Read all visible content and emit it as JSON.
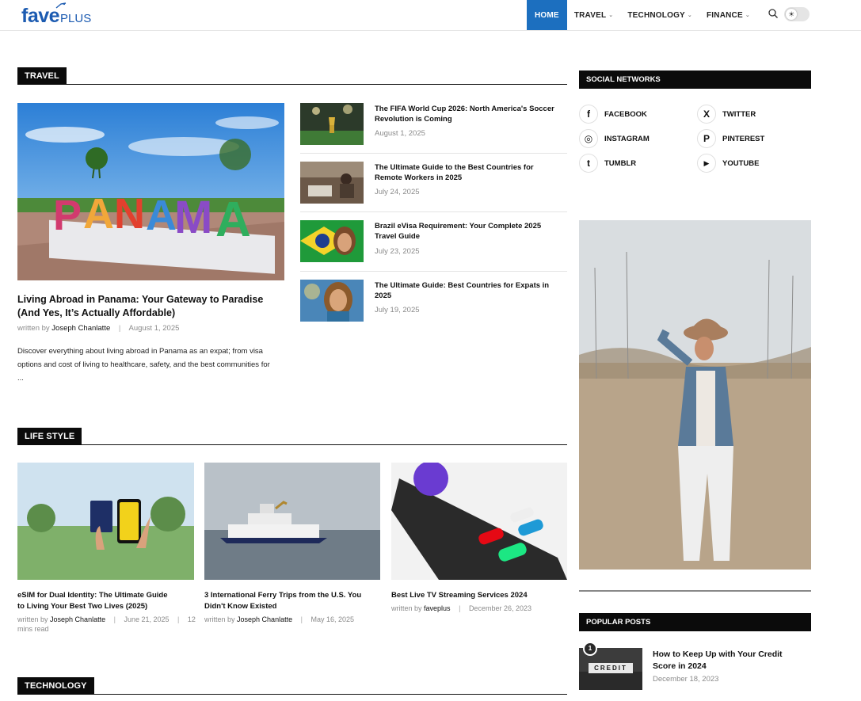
{
  "header": {
    "logo_main": "fave",
    "logo_plus": "PLUS",
    "nav": [
      {
        "label": "HOME",
        "active": true
      },
      {
        "label": "TRAVEL",
        "caret": true
      },
      {
        "label": "TECHNOLOGY",
        "caret": true
      },
      {
        "label": "FINANCE",
        "caret": true
      }
    ],
    "toggle_icon": "sun-icon",
    "accent": "#1c6fbf"
  },
  "travel": {
    "heading": "TRAVEL",
    "featured": {
      "image_icon": "panama-sign-photo",
      "title_line1": "Living Abroad in Panama: Your Gateway to Paradise",
      "title_line2": "(And Yes, It’s Actually Affordable)",
      "written_by": "written by",
      "author": "Joseph Chanlatte",
      "date": "August 1, 2025",
      "excerpt_line1": "Discover everything about living abroad in Panama as an expat; from visa",
      "excerpt_line2": "options and cost of living to healthcare, safety, and the best communities for",
      "excerpt_line3": "..."
    },
    "list": [
      {
        "title_line1": "The FIFA World Cup 2026: North America's Soccer",
        "title_line2": "Revolution is Coming",
        "date": "August 1, 2025"
      },
      {
        "title_line1": "The Ultimate Guide to the Best Countries for",
        "title_line2": "Remote Workers in 2025",
        "date": "July 24, 2025"
      },
      {
        "title_line1": "Brazil eVisa Requirement: Your Complete 2025",
        "title_line2": "Travel Guide",
        "date": "July 23, 2025"
      },
      {
        "title_line1": "The Ultimate Guide: Best Countries for Expats in",
        "title_line2": "2025",
        "date": "July 19, 2025"
      }
    ]
  },
  "lifestyle": {
    "heading": "LIFE STYLE",
    "posts": [
      {
        "title_line1": "eSIM for Dual Identity: The Ultimate Guide",
        "title_line2": "to Living Your Best Two Lives (2025)",
        "written_by": "written by",
        "author": "Joseph Chanlatte",
        "date": "June 21, 2025",
        "extra": "12",
        "extra2": "mins read"
      },
      {
        "title_line1": "3 International Ferry Trips from the U.S. You",
        "title_line2": "Didn't Know Existed",
        "written_by": "written by",
        "author": "Joseph Chanlatte",
        "date": "May 16, 2025"
      },
      {
        "title_line1": "Best Live TV Streaming Services 2024",
        "title_line2": "",
        "written_by": "written by",
        "author": "faveplus",
        "date": "December 26, 2023"
      }
    ]
  },
  "technology": {
    "heading": "TECHNOLOGY"
  },
  "sidebar": {
    "social_heading": "SOCIAL NETWORKS",
    "social": [
      {
        "label": "FACEBOOK",
        "glyph": "f"
      },
      {
        "label": "TWITTER",
        "glyph": "X"
      },
      {
        "label": "INSTAGRAM",
        "glyph": "◎"
      },
      {
        "label": "PINTEREST",
        "glyph": "P"
      },
      {
        "label": "TUMBLR",
        "glyph": "t"
      },
      {
        "label": "YOUTUBE",
        "glyph": "▶"
      }
    ],
    "popular_heading": "POPULAR POSTS",
    "popular": [
      {
        "rank": "1",
        "image_text": "CREDIT",
        "title_line1": "How to Keep Up with Your Credit",
        "title_line2": "Score in 2024",
        "date": "December 18, 2023"
      }
    ]
  }
}
